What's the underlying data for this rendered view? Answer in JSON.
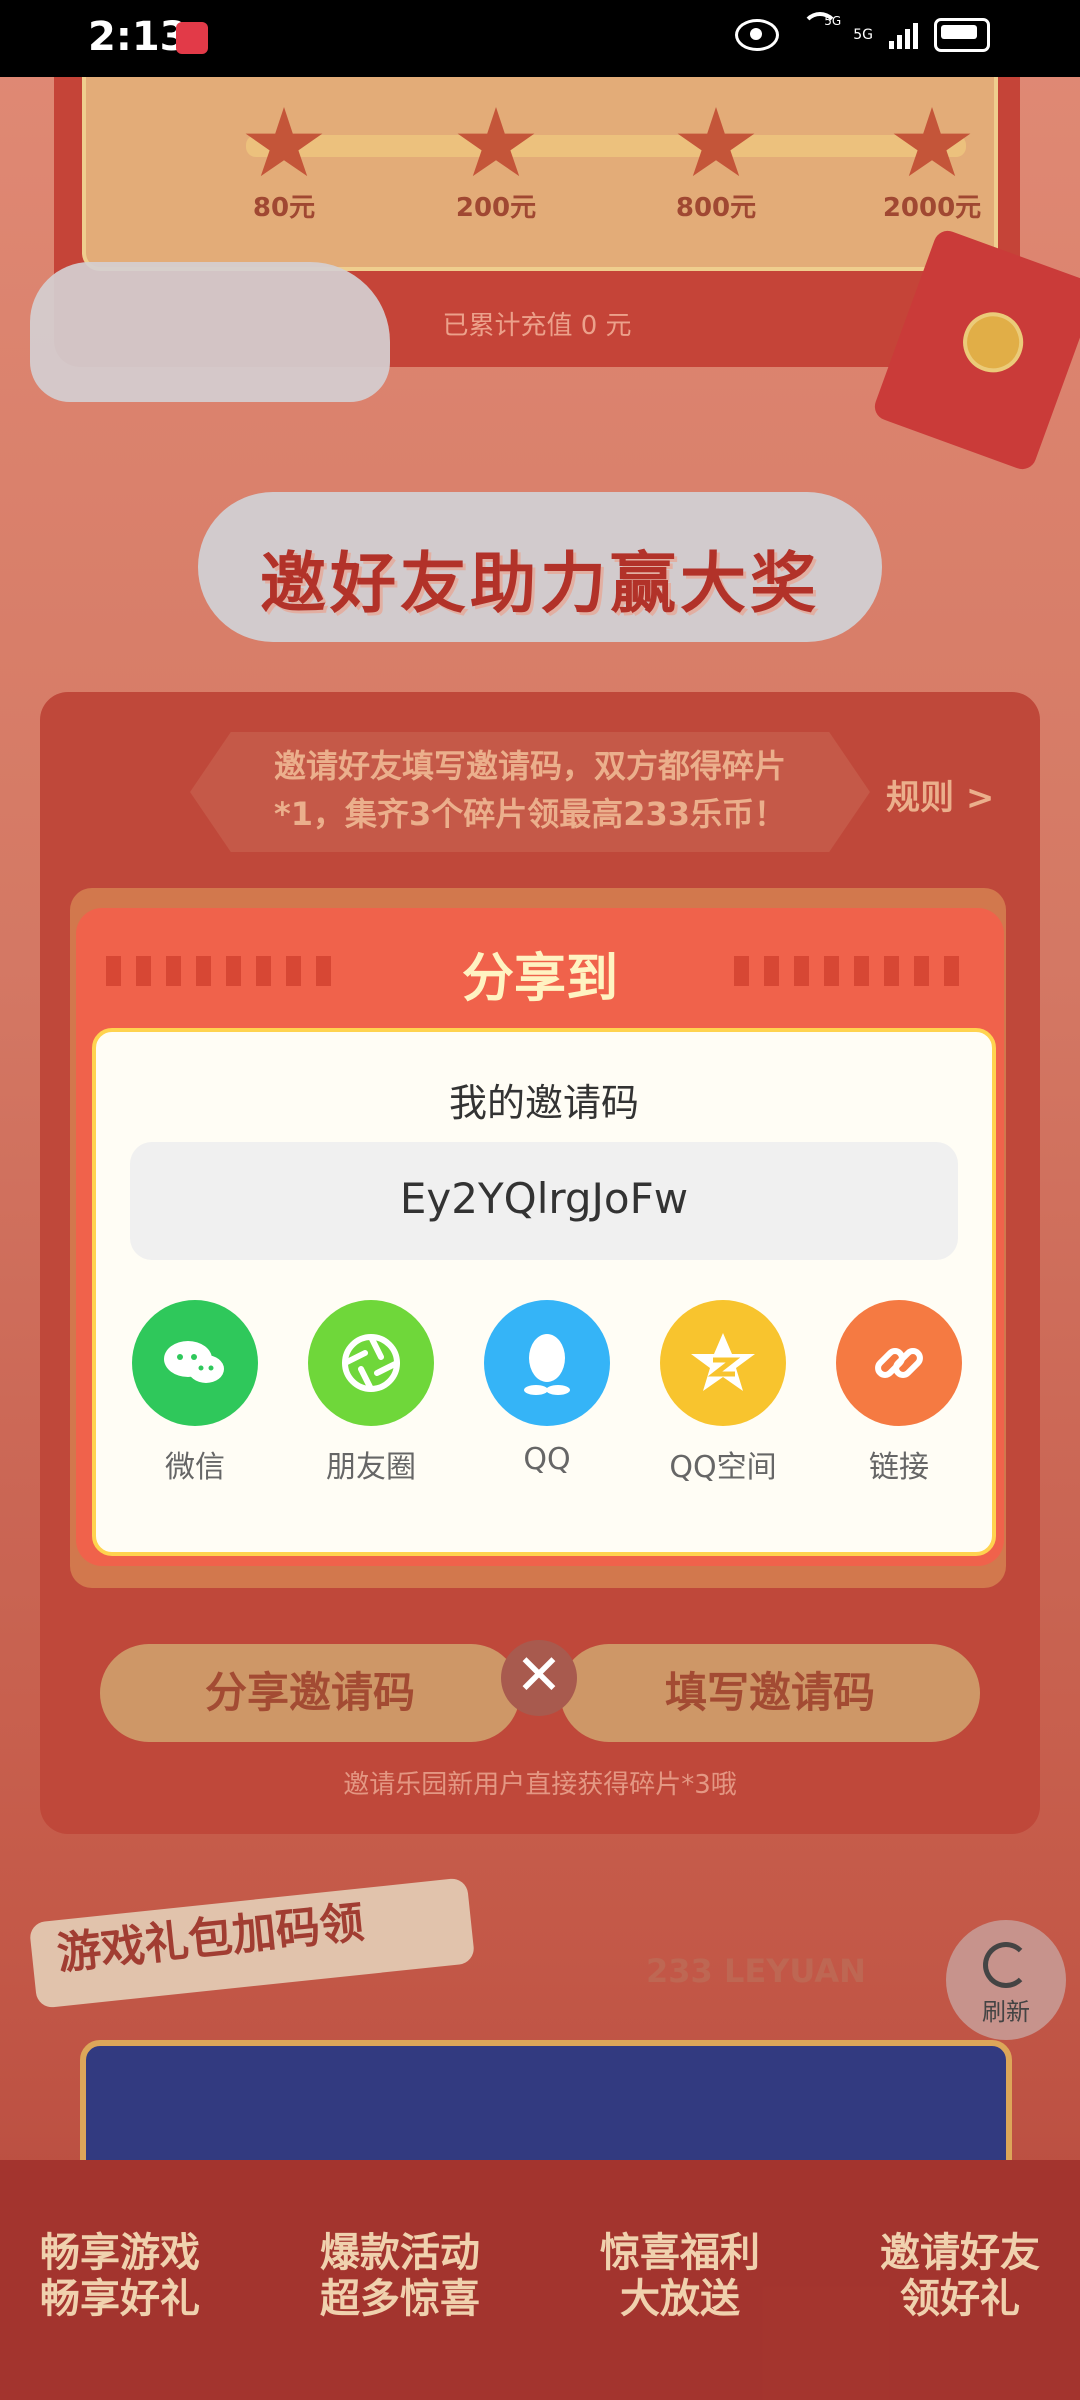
{
  "status_bar": {
    "time": "2:13",
    "network": "5G"
  },
  "rewards": {
    "milestones": [
      "80元",
      "200元",
      "800元",
      "2000元"
    ],
    "recharge_text": "已累计充值 0 元"
  },
  "section_title": "邀好友助力赢大奖",
  "invite_panel": {
    "info_text_line1": "邀请好友填写邀请码，双方都得碎片",
    "info_text_line2": "*1，集齐3个碎片领最高233乐币！",
    "rules_label": "规则 >",
    "share_code_button": "分享邀请码",
    "fill_code_button": "填写邀请码",
    "hint": "邀请乐园新用户直接获得碎片*3哦"
  },
  "modal": {
    "title": "分享到",
    "invite_code_label": "我的邀请码",
    "invite_code": "Ey2YQlrgJoFw",
    "close_label": "✕",
    "share_targets": [
      {
        "label": "微信",
        "icon": "wechat-icon",
        "color": "#2fc85b"
      },
      {
        "label": "朋友圈",
        "icon": "moments-icon",
        "color": "#6fd73a"
      },
      {
        "label": "QQ",
        "icon": "qq-icon",
        "color": "#35b4f7"
      },
      {
        "label": "QQ空间",
        "icon": "qzone-icon",
        "color": "#f8c42e"
      },
      {
        "label": "链接",
        "icon": "link-icon",
        "color": "#f57a42"
      }
    ]
  },
  "gift_section": {
    "title": "游戏礼包加码领",
    "brand": "233 LEYUAN",
    "refresh_label": "刷新"
  },
  "bottom_nav": [
    {
      "line1": "畅享游戏",
      "line2": "畅享好礼"
    },
    {
      "line1": "爆款活动",
      "line2": "超多惊喜"
    },
    {
      "line1": "惊喜福利",
      "line2": "大放送"
    },
    {
      "line1": "邀请好友",
      "line2": "领好礼"
    }
  ]
}
